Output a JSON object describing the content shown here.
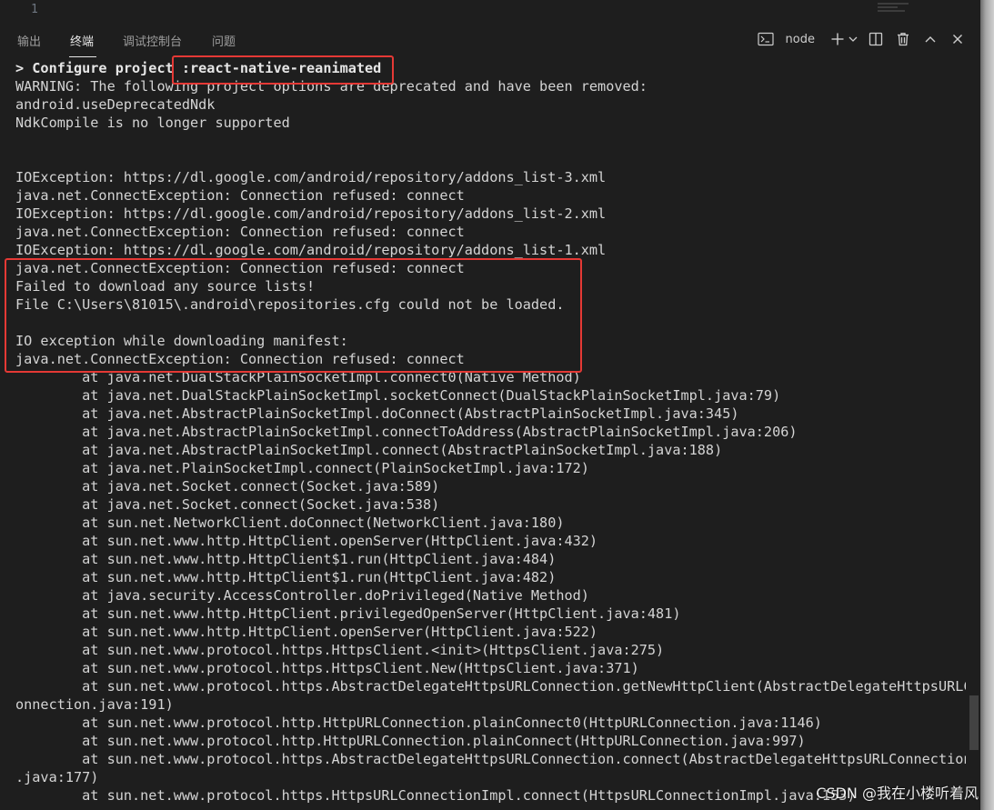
{
  "editor": {
    "line_number": "1"
  },
  "panel": {
    "tabs": [
      {
        "label": "输出"
      },
      {
        "label": "终端"
      },
      {
        "label": "调试控制台"
      },
      {
        "label": "问题"
      }
    ],
    "active_tab": "终端",
    "terminal_name": "node"
  },
  "terminal": {
    "lines": [
      "> Configure project :react-native-reanimated",
      "WARNING: The following project options are deprecated and have been removed:",
      "android.useDeprecatedNdk",
      "NdkCompile is no longer supported",
      "",
      "",
      "IOException: https://dl.google.com/android/repository/addons_list-3.xml",
      "java.net.ConnectException: Connection refused: connect",
      "IOException: https://dl.google.com/android/repository/addons_list-2.xml",
      "java.net.ConnectException: Connection refused: connect",
      "IOException: https://dl.google.com/android/repository/addons_list-1.xml",
      "java.net.ConnectException: Connection refused: connect",
      "Failed to download any source lists!",
      "File C:\\Users\\81015\\.android\\repositories.cfg could not be loaded.",
      "",
      "IO exception while downloading manifest:",
      "java.net.ConnectException: Connection refused: connect",
      "        at java.net.DualStackPlainSocketImpl.connect0(Native Method)",
      "        at java.net.DualStackPlainSocketImpl.socketConnect(DualStackPlainSocketImpl.java:79)",
      "        at java.net.AbstractPlainSocketImpl.doConnect(AbstractPlainSocketImpl.java:345)",
      "        at java.net.AbstractPlainSocketImpl.connectToAddress(AbstractPlainSocketImpl.java:206)",
      "        at java.net.AbstractPlainSocketImpl.connect(AbstractPlainSocketImpl.java:188)",
      "        at java.net.PlainSocketImpl.connect(PlainSocketImpl.java:172)",
      "        at java.net.Socket.connect(Socket.java:589)",
      "        at java.net.Socket.connect(Socket.java:538)",
      "        at sun.net.NetworkClient.doConnect(NetworkClient.java:180)",
      "        at sun.net.www.http.HttpClient.openServer(HttpClient.java:432)",
      "        at sun.net.www.http.HttpClient$1.run(HttpClient.java:484)",
      "        at sun.net.www.http.HttpClient$1.run(HttpClient.java:482)",
      "        at java.security.AccessController.doPrivileged(Native Method)",
      "        at sun.net.www.http.HttpClient.privilegedOpenServer(HttpClient.java:481)",
      "        at sun.net.www.http.HttpClient.openServer(HttpClient.java:522)",
      "        at sun.net.www.protocol.https.HttpsClient.<init>(HttpsClient.java:275)",
      "        at sun.net.www.protocol.https.HttpsClient.New(HttpsClient.java:371)",
      "        at sun.net.www.protocol.https.AbstractDelegateHttpsURLConnection.getNewHttpClient(AbstractDelegateHttpsURLC",
      "onnection.java:191)",
      "        at sun.net.www.protocol.http.HttpURLConnection.plainConnect0(HttpURLConnection.java:1146)",
      "        at sun.net.www.protocol.http.HttpURLConnection.plainConnect(HttpURLConnection.java:997)",
      "        at sun.net.www.protocol.https.AbstractDelegateHttpsURLConnection.connect(AbstractDelegateHttpsURLConnection",
      ".java:177)",
      "        at sun.net.www.protocol.https.HttpsURLConnectionImpl.connect(HttpsURLConnectionImpl.java:153)"
    ]
  },
  "watermark": "CSDN @我在小楼听着风",
  "colors": {
    "background": "#1e1e1e",
    "text": "#d4d4d4",
    "highlight_border": "#e53935"
  }
}
